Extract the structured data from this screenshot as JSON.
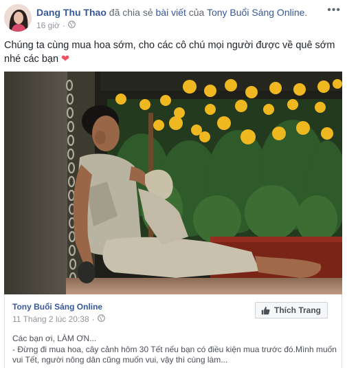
{
  "post": {
    "author": "Dang Thu Thao",
    "action": "đã chia sẻ",
    "object": "bài viết",
    "of": "của",
    "source_page": "Tony Buổi Sáng Online",
    "time": "16 giờ",
    "audience_icon": "globe-icon",
    "more_label": "•••",
    "text_line1": "Chúng ta cùng mua hoa sớm, cho các cô chú mọi người được về quê sớm",
    "text_line2": "nhé các bạn",
    "emoji": "❤"
  },
  "shared": {
    "page_name": "Tony Buổi Sáng Online",
    "date": "11 Tháng 2 lúc 20:38",
    "audience_icon": "globe-icon",
    "like_button": "Thích Trang",
    "text_line1": "Các bạn ơi, LÀM ƠN...",
    "text_line2": "- Đừng đi mua hoa, cây cảnh hôm 30 Tết nếu bạn có điều kiện mua trước đó.Mình muốn",
    "text_line3": "vui Tết, người nông dân cũng muốn vui, vậy thì cùng làm..."
  },
  "colors": {
    "link": "#365899",
    "secondary": "#90949c",
    "heart": "#f25268",
    "flower": "#f0b820"
  }
}
